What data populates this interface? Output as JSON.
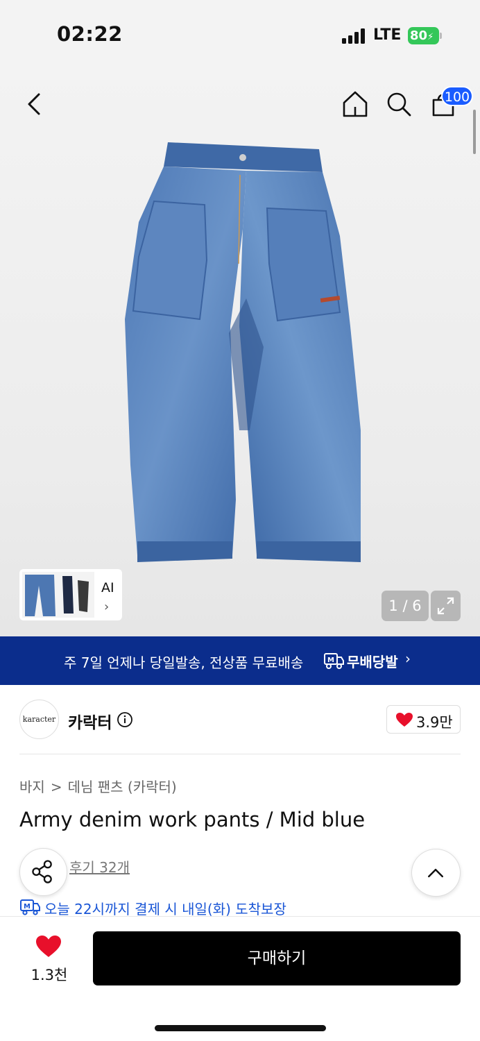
{
  "status_bar": {
    "time": "02:22",
    "network": "LTE",
    "battery": "80"
  },
  "nav": {
    "cart_count": "100",
    "icons": [
      "back-icon",
      "home-icon",
      "search-icon",
      "cart-icon"
    ]
  },
  "gallery": {
    "thumb_label": "AI",
    "thumb_chevron": "›",
    "page_counter": "1 / 6"
  },
  "banner": {
    "text": "주 7일 언제나 당일발송, 전상품 무료배송",
    "brand": "무배당발",
    "chevron": "›",
    "color": "#0b2d8c"
  },
  "brand": {
    "logo_text": "karacter",
    "name": "카락터",
    "like_count": "3.9만"
  },
  "breadcrumb": {
    "category": "바지",
    "separator": ">",
    "subcategory": "데님 팬츠 (카락터)"
  },
  "product": {
    "title": "Army denim work pants / Mid blue",
    "review_link": "후기 32개",
    "delivery_note": "오늘 22시까지 결제 시 내일(화) 도착보장",
    "delivery_color": "#1a56d6"
  },
  "bottom_bar": {
    "wish_count": "1.3천",
    "buy_label": "구매하기"
  },
  "colors": {
    "badge": "#1a5cff",
    "heart": "#e8102b",
    "battery": "#34c759"
  }
}
